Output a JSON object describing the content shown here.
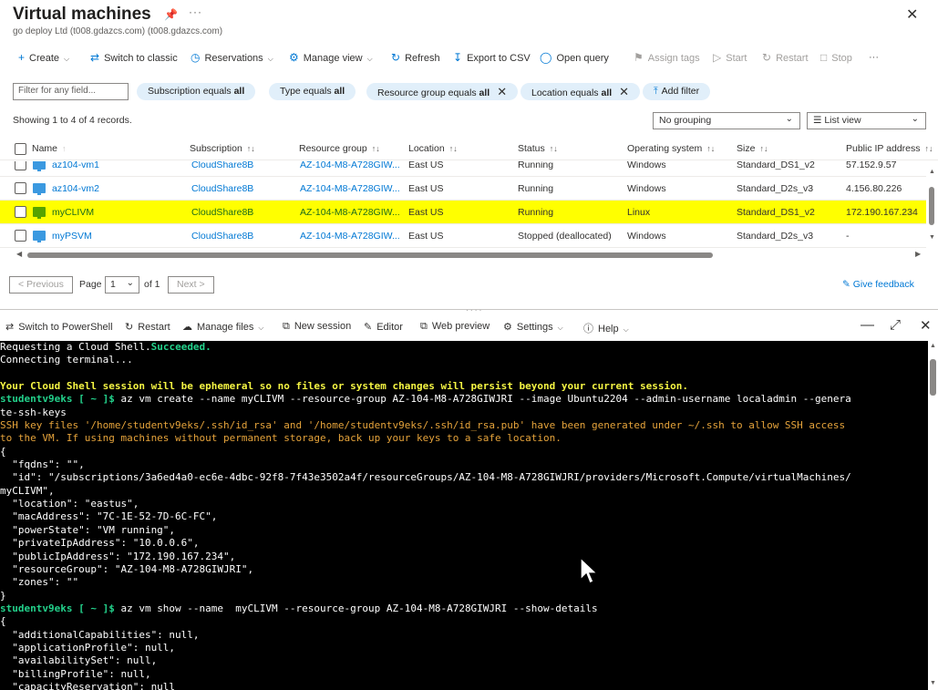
{
  "header": {
    "title": "Virtual machines",
    "subtitle": "go deploy Ltd (t008.gdazcs.com) (t008.gdazcs.com)"
  },
  "toolbar": {
    "create": "Create",
    "switch_classic": "Switch to classic",
    "reservations": "Reservations",
    "manage_view": "Manage view",
    "refresh": "Refresh",
    "export_csv": "Export to CSV",
    "open_query": "Open query",
    "assign_tags": "Assign tags",
    "start": "Start",
    "restart": "Restart",
    "stop": "Stop"
  },
  "filters": {
    "placeholder": "Filter for any field...",
    "pills": [
      {
        "field": "Subscription equals ",
        "value": "all"
      },
      {
        "field": "Type equals ",
        "value": "all"
      },
      {
        "field": "Resource group equals ",
        "value": "all"
      },
      {
        "field": "Location equals ",
        "value": "all"
      }
    ],
    "add_filter": "Add filter"
  },
  "records_text": "Showing 1 to 4 of 4 records.",
  "grouping": "No grouping",
  "view_mode": "List view",
  "table": {
    "columns": [
      "Name",
      "Subscription",
      "Resource group",
      "Location",
      "Status",
      "Operating system",
      "Size",
      "Public IP address"
    ],
    "rows": [
      {
        "name": "az104-vm1",
        "subscription": "CloudShare8B",
        "rg": "AZ-104-M8-A728GIW...",
        "location": "East US",
        "status": "Running",
        "os": "Windows",
        "size": "Standard_DS1_v2",
        "ip": "57.152.9.57"
      },
      {
        "name": "az104-vm2",
        "subscription": "CloudShare8B",
        "rg": "AZ-104-M8-A728GIW...",
        "location": "East US",
        "status": "Running",
        "os": "Windows",
        "size": "Standard_D2s_v3",
        "ip": "4.156.80.226"
      },
      {
        "name": "myCLIVM",
        "subscription": "CloudShare8B",
        "rg": "AZ-104-M8-A728GIW...",
        "location": "East US",
        "status": "Running",
        "os": "Linux",
        "size": "Standard_DS1_v2",
        "ip": "172.190.167.234"
      },
      {
        "name": "myPSVM",
        "subscription": "CloudShare8B",
        "rg": "AZ-104-M8-A728GIW...",
        "location": "East US",
        "status": "Stopped (deallocated)",
        "os": "Windows",
        "size": "Standard_D2s_v3",
        "ip": "-"
      }
    ]
  },
  "pager": {
    "previous": "< Previous",
    "page_label": "Page",
    "page_value": "1",
    "of_label": "of 1",
    "next": "Next >",
    "feedback": "Give feedback"
  },
  "shell": {
    "switch_ps": "Switch to PowerShell",
    "restart": "Restart",
    "manage_files": "Manage files",
    "new_session": "New session",
    "editor": "Editor",
    "web_preview": "Web preview",
    "settings": "Settings",
    "help": "Help"
  },
  "terminal": {
    "lines": [
      {
        "parts": [
          {
            "t": "Requesting a Cloud Shell.",
            "c": ""
          },
          {
            "t": "Succeeded.",
            "c": "t-green"
          }
        ]
      },
      {
        "parts": [
          {
            "t": "Connecting terminal...",
            "c": ""
          }
        ]
      },
      {
        "parts": [
          {
            "t": "",
            "c": ""
          }
        ]
      },
      {
        "parts": [
          {
            "t": "Your Cloud Shell session will be ephemeral so no files or system changes will persist beyond your current session.",
            "c": "t-yellow"
          }
        ]
      },
      {
        "parts": [
          {
            "t": "studentv9eks [ ~ ]$ ",
            "c": "t-prompt"
          },
          {
            "t": "az vm create --name myCLIVM --resource-group AZ-104-M8-A728GIWJRI --image Ubuntu2204 --admin-username localadmin --genera",
            "c": ""
          }
        ]
      },
      {
        "parts": [
          {
            "t": "te-ssh-keys",
            "c": ""
          }
        ]
      },
      {
        "parts": [
          {
            "t": "SSH key files '/home/studentv9eks/.ssh/id_rsa' and '/home/studentv9eks/.ssh/id_rsa.pub' have been generated under ~/.ssh to allow SSH access",
            "c": "t-orange"
          }
        ]
      },
      {
        "parts": [
          {
            "t": "to the VM. If using machines without permanent storage, back up your keys to a safe location.",
            "c": "t-orange"
          }
        ]
      },
      {
        "parts": [
          {
            "t": "{",
            "c": ""
          }
        ]
      },
      {
        "parts": [
          {
            "t": "  \"fqdns\": \"\",",
            "c": ""
          }
        ]
      },
      {
        "parts": [
          {
            "t": "  \"id\": \"/subscriptions/3a6ed4a0-ec6e-4dbc-92f8-7f43e3502a4f/resourceGroups/AZ-104-M8-A728GIWJRI/providers/Microsoft.Compute/virtualMachines/",
            "c": ""
          }
        ]
      },
      {
        "parts": [
          {
            "t": "myCLIVM\",",
            "c": ""
          }
        ]
      },
      {
        "parts": [
          {
            "t": "  \"location\": \"eastus\",",
            "c": ""
          }
        ]
      },
      {
        "parts": [
          {
            "t": "  \"macAddress\": \"7C-1E-52-7D-6C-FC\",",
            "c": ""
          }
        ]
      },
      {
        "parts": [
          {
            "t": "  \"powerState\": \"VM running\",",
            "c": ""
          }
        ]
      },
      {
        "parts": [
          {
            "t": "  \"privateIpAddress\": \"10.0.0.6\",",
            "c": ""
          }
        ]
      },
      {
        "parts": [
          {
            "t": "  \"publicIpAddress\": \"172.190.167.234\",",
            "c": ""
          }
        ]
      },
      {
        "parts": [
          {
            "t": "  \"resourceGroup\": \"AZ-104-M8-A728GIWJRI\",",
            "c": ""
          }
        ]
      },
      {
        "parts": [
          {
            "t": "  \"zones\": \"\"",
            "c": ""
          }
        ]
      },
      {
        "parts": [
          {
            "t": "}",
            "c": ""
          }
        ]
      },
      {
        "parts": [
          {
            "t": "studentv9eks [ ~ ]$ ",
            "c": "t-prompt"
          },
          {
            "t": "az vm show --name  myCLIVM --resource-group AZ-104-M8-A728GIWJRI --show-details",
            "c": ""
          }
        ]
      },
      {
        "parts": [
          {
            "t": "{",
            "c": ""
          }
        ]
      },
      {
        "parts": [
          {
            "t": "  \"additionalCapabilities\": null,",
            "c": ""
          }
        ]
      },
      {
        "parts": [
          {
            "t": "  \"applicationProfile\": null,",
            "c": ""
          }
        ]
      },
      {
        "parts": [
          {
            "t": "  \"availabilitySet\": null,",
            "c": ""
          }
        ]
      },
      {
        "parts": [
          {
            "t": "  \"billingProfile\": null,",
            "c": ""
          }
        ]
      },
      {
        "parts": [
          {
            "t": "  \"capacityReservation\": null",
            "c": ""
          }
        ]
      }
    ]
  }
}
